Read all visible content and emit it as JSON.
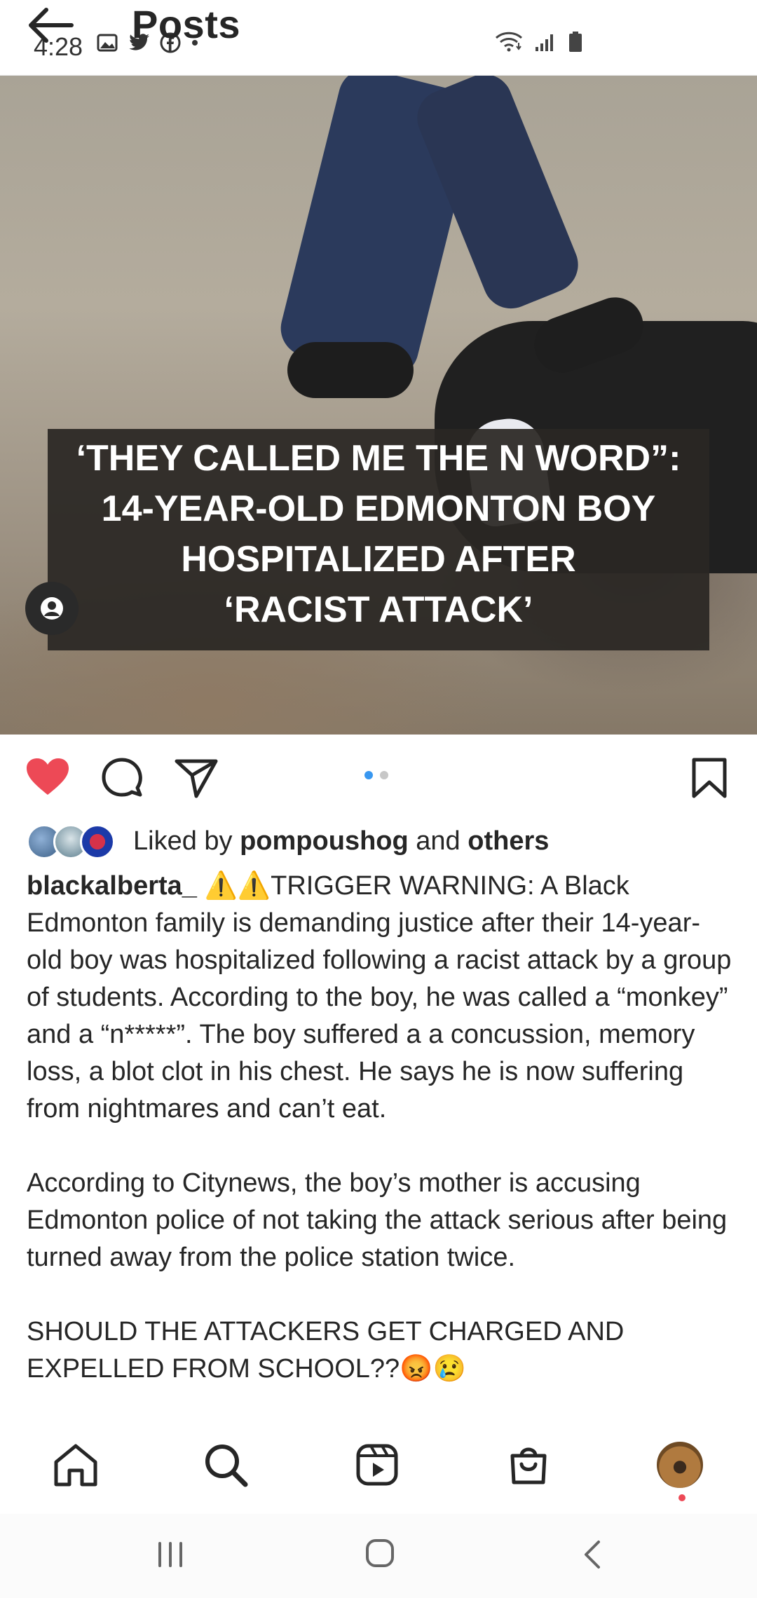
{
  "status_bar": {
    "time": "4:28",
    "left_icons": [
      "image-icon",
      "twitter-icon",
      "facebook-icon",
      "dot-icon"
    ],
    "right_icons": [
      "wifi-icon",
      "signal-icon",
      "battery-icon"
    ]
  },
  "header": {
    "title": "Posts",
    "back_icon": "arrow-left-icon"
  },
  "post": {
    "media_overlay_lines": [
      "‘THEY CALLED ME THE N WORD”:",
      "14-YEAR-OLD EDMONTON BOY",
      "HOSPITALIZED AFTER",
      "‘RACIST ATTACK’"
    ],
    "carousel": {
      "count": 2,
      "active_index": 0
    },
    "liked": true,
    "likes": {
      "prefix": "Liked by ",
      "user": "pompoushog",
      "middle": " and ",
      "others": "others"
    },
    "caption": {
      "username": "blackalberta_",
      "text": " ⚠️⚠️TRIGGER WARNING: A Black Edmonton family is demanding justice after their 14-year-old boy was hospitalized following a racist attack by a group of students. According to the boy, he was called a “monkey” and a “n*****”. The boy suffered a a concussion, memory loss, a blot clot in his chest. He says he is now suffering from nightmares and can’t eat.\n\nAccording to Citynews, the boy’s mother is accusing Edmonton police of not taking the attack serious after being turned away from the police station twice.\n\nSHOULD THE ATTACKERS GET CHARGED AND EXPELLED FROM SCHOOL??😡😢"
    }
  },
  "bottom_nav": [
    "home-icon",
    "search-icon",
    "reels-icon",
    "shop-icon",
    "profile-avatar"
  ],
  "system_nav": [
    "recents-icon",
    "home-button-icon",
    "back-icon"
  ],
  "colors": {
    "like_red": "#ed4956",
    "carousel_active": "#3897f0"
  }
}
